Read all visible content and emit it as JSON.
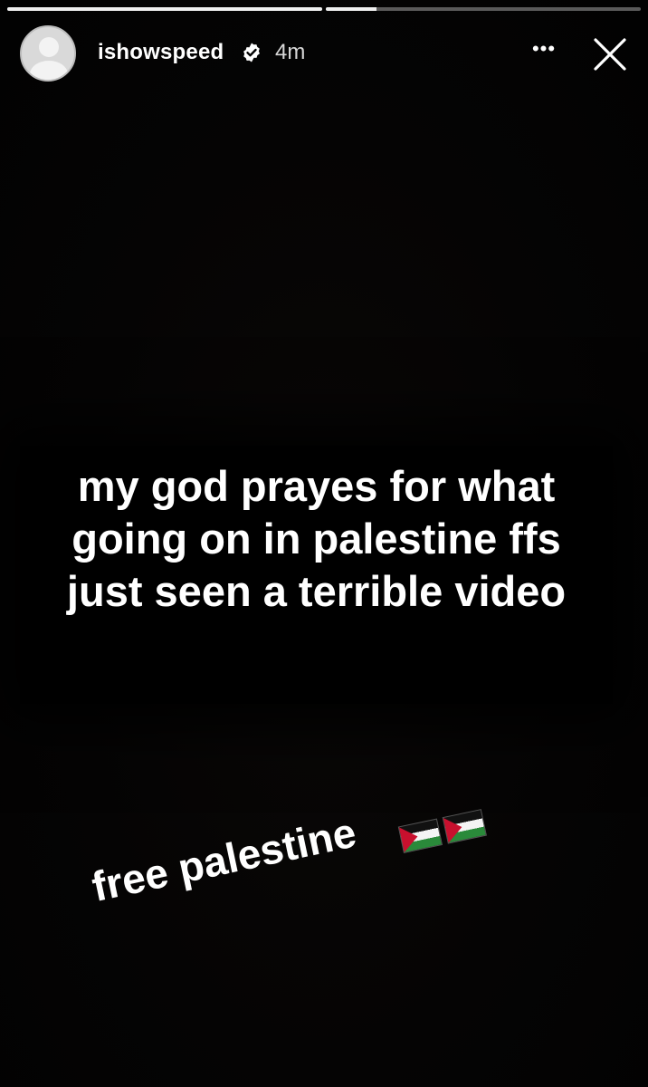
{
  "story": {
    "progress_segments": [
      {
        "state": "viewed",
        "fill": 1.0
      },
      {
        "state": "current",
        "fill": 0.16
      }
    ],
    "header": {
      "username": "ishowspeed",
      "verified_icon": "verified-badge-icon",
      "time": "4m",
      "more_icon": "more-horizontal-icon",
      "more_glyph": "•••",
      "close_icon": "close-icon"
    },
    "caption": {
      "lines": [
        "my god prayes for what",
        "going on in palestine ffs",
        "just seen a terrible video"
      ]
    },
    "sticker": {
      "text": "free palestine",
      "flags": [
        "palestine-flag-icon",
        "palestine-flag-icon"
      ]
    }
  },
  "colors": {
    "background": "#000000",
    "text": "#ffffff",
    "flag_black": "#111111",
    "flag_white": "#f4f4f4",
    "flag_green": "#2a8a3a",
    "flag_red": "#c8102e"
  }
}
